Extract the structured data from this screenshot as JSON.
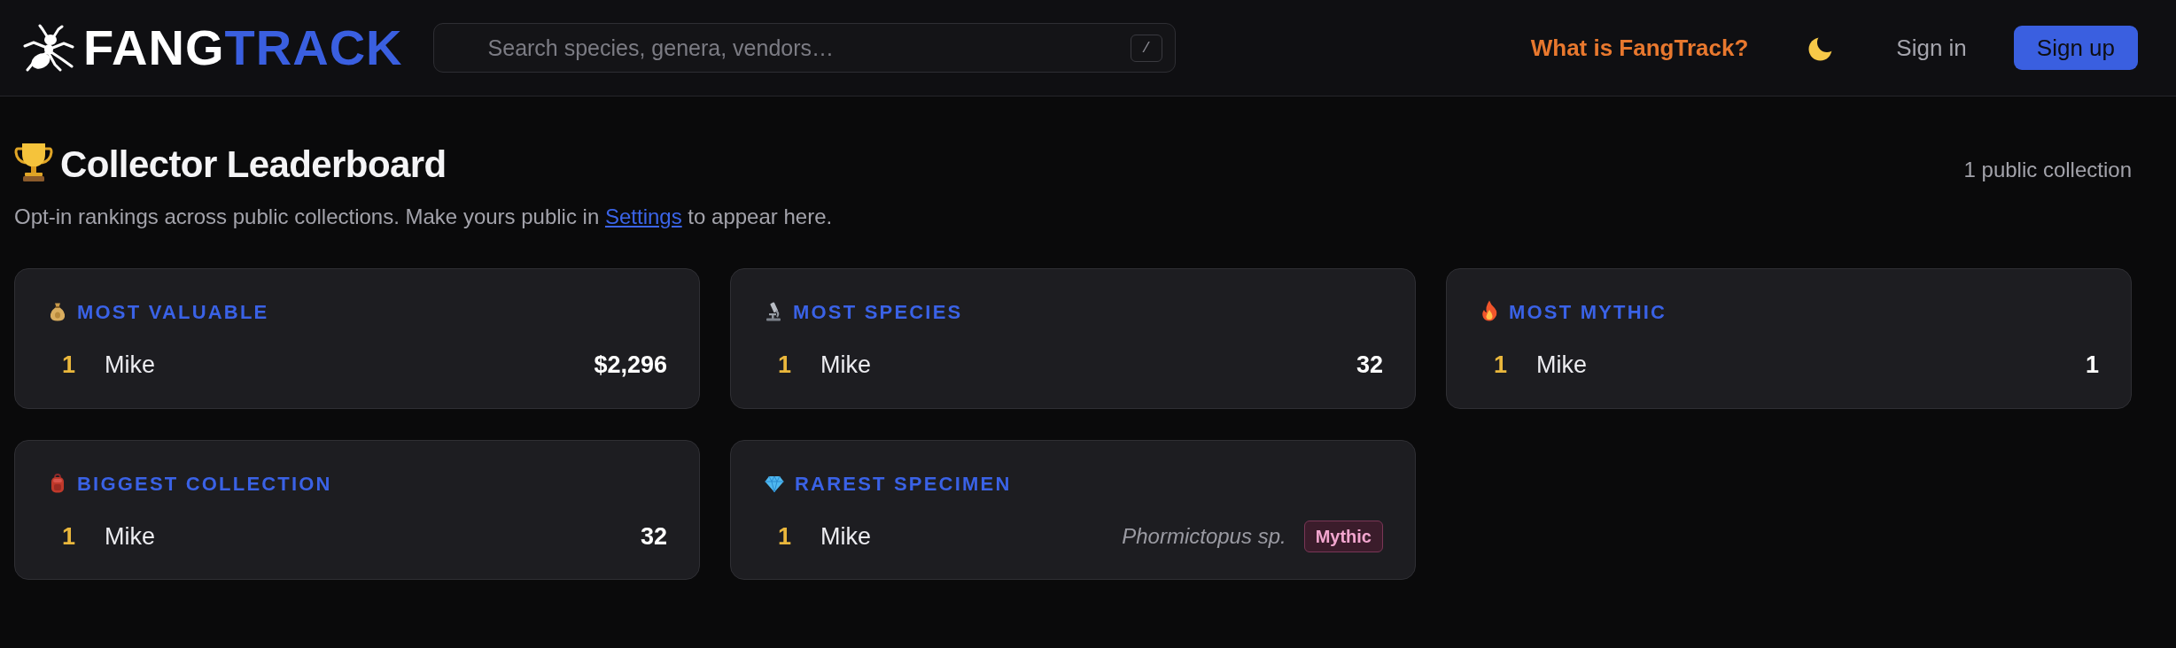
{
  "header": {
    "logo": {
      "first": "FANG",
      "second": "TRACK"
    },
    "search": {
      "placeholder": "Search species, genera, vendors…",
      "shortcut": "/"
    },
    "about_link": "What is FangTrack?",
    "sign_in": "Sign in",
    "sign_up": "Sign up"
  },
  "page": {
    "title": "Collector Leaderboard",
    "count": "1 public collection",
    "description": {
      "before": "Opt-in rankings across public collections. Make yours public in ",
      "link": "Settings",
      "after": " to appear here."
    }
  },
  "cards": [
    {
      "title": "MOST VALUABLE",
      "entries": [
        {
          "kind": "value",
          "rank": "1",
          "name": "Mike",
          "value": "$2,296"
        }
      ]
    },
    {
      "title": "MOST SPECIES",
      "entries": [
        {
          "kind": "value",
          "rank": "1",
          "name": "Mike",
          "value": "32"
        }
      ]
    },
    {
      "title": "MOST MYTHIC",
      "entries": [
        {
          "kind": "value",
          "rank": "1",
          "name": "Mike",
          "value": "1"
        }
      ]
    },
    {
      "title": "BIGGEST COLLECTION",
      "entries": [
        {
          "kind": "value",
          "rank": "1",
          "name": "Mike",
          "value": "32"
        }
      ]
    },
    {
      "title": "RAREST SPECIMEN",
      "entries": [
        {
          "kind": "specimen",
          "rank": "1",
          "name": "Mike",
          "species": "Phormictopus sp.",
          "badge": "Mythic"
        }
      ]
    }
  ]
}
